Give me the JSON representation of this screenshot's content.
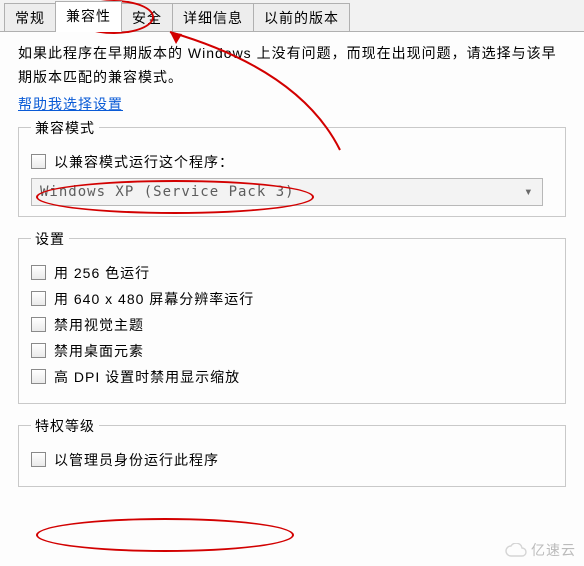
{
  "tabs": {
    "general": "常规",
    "compat": "兼容性",
    "security": "安全",
    "details": "详细信息",
    "prev": "以前的版本"
  },
  "intro": "如果此程序在早期版本的 Windows 上没有问题，而现在出现问题，请选择与该早期版本匹配的兼容模式。",
  "help_link": "帮助我选择设置",
  "compat_group": {
    "legend": "兼容模式",
    "checkbox": "以兼容模式运行这个程序：",
    "dropdown": "Windows XP (Service Pack 3)"
  },
  "settings_group": {
    "legend": "设置",
    "opt256": "用 256 色运行",
    "opt640": "用 640 x 480 屏幕分辨率运行",
    "optTheme": "禁用视觉主题",
    "optDesk": "禁用桌面元素",
    "optDpi": "高 DPI 设置时禁用显示缩放"
  },
  "priv_group": {
    "legend": "特权等级",
    "admin": "以管理员身份运行此程序"
  },
  "watermark": "亿速云"
}
